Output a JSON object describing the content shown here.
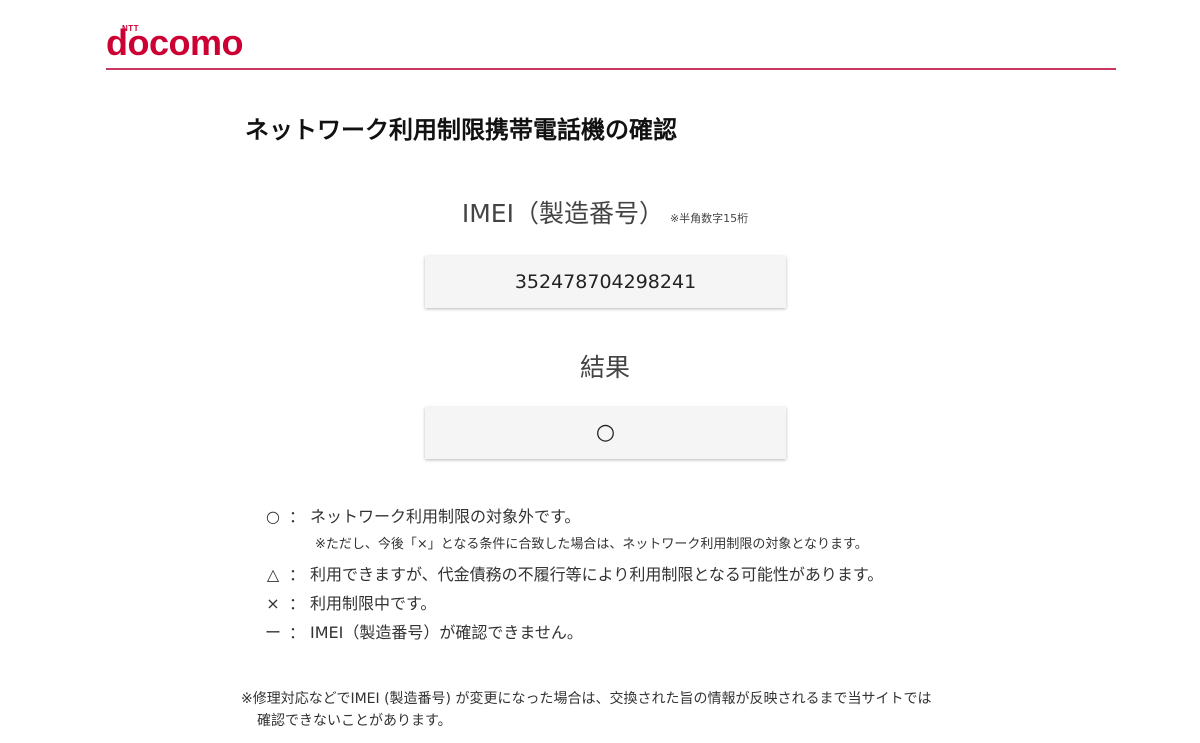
{
  "header": {
    "logo_small": "NTT",
    "logo_text": "docomo",
    "brand_color": "#cc0033",
    "rule_color": "#c8385e"
  },
  "page": {
    "title": "ネットワーク利用制限携帯電話機の確認"
  },
  "imei": {
    "label": "IMEI（製造番号）",
    "note": "※半角数字15桁",
    "value": "352478704298241"
  },
  "result": {
    "label": "結果",
    "value": "○"
  },
  "legend": {
    "items": [
      {
        "symbol": "○",
        "colon": "：",
        "text": "ネットワーク利用制限の対象外です。"
      },
      {
        "symbol": "△",
        "colon": "：",
        "text": "利用できますが、代金債務の不履行等により利用制限となる可能性があります。"
      },
      {
        "symbol": "×",
        "colon": "：",
        "text": "利用制限中です。"
      },
      {
        "symbol": "ー",
        "colon": "：",
        "text": "IMEI（製造番号）が確認できません。"
      }
    ],
    "circle_subnote": "※ただし、今後「×」となる条件に合致した場合は、ネットワーク利用制限の対象となります。"
  },
  "footnote": {
    "line1": "※修理対応などでIMEI (製造番号) が変更になった場合は、交換された旨の情報が反映されるまで当サイトでは",
    "line2": "確認できないことがあります。"
  }
}
